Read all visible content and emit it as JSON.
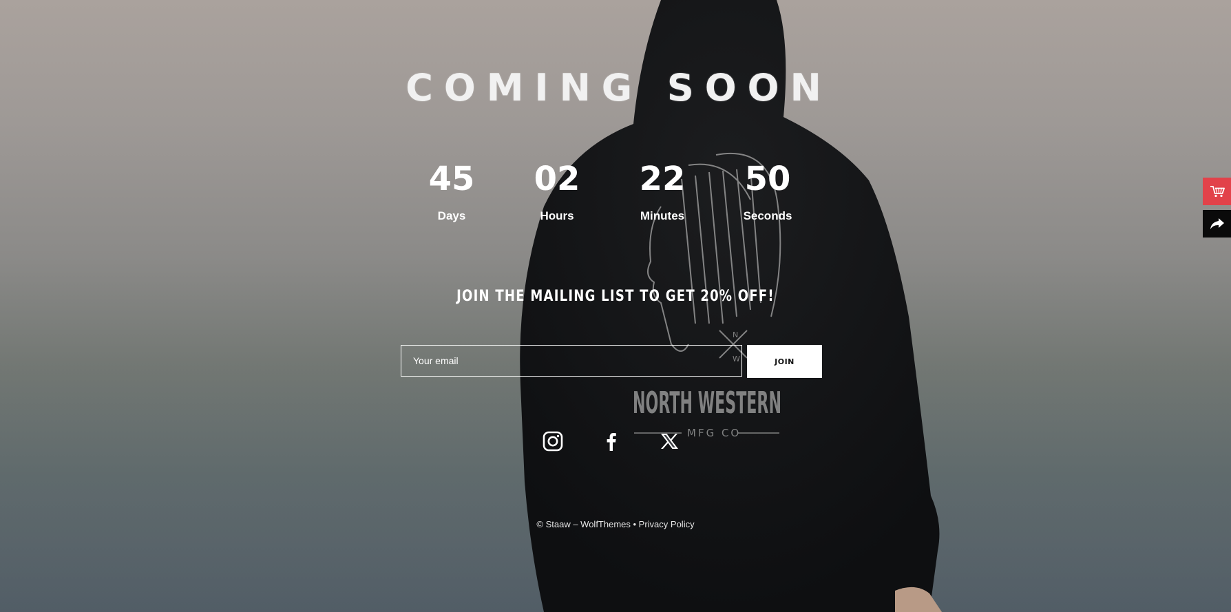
{
  "page": {
    "title": "COMING SOON"
  },
  "countdown": [
    {
      "value": "45",
      "label": "Days"
    },
    {
      "value": "02",
      "label": "Hours"
    },
    {
      "value": "22",
      "label": "Minutes"
    },
    {
      "value": "50",
      "label": "Seconds"
    }
  ],
  "mailing": {
    "heading": "JOIN THE MAILING LIST TO GET 20% OFF!",
    "email_placeholder": "Your email",
    "email_value": "",
    "join_label": "JOIN"
  },
  "social": {
    "icons": [
      "instagram-icon",
      "facebook-icon",
      "x-twitter-icon"
    ]
  },
  "footer": {
    "copyright": "© Staaw – WolfThemes",
    "separator": " • ",
    "privacy_link": "Privacy Policy"
  },
  "side_buttons": {
    "cart_icon": "cart-icon",
    "share_icon": "share-icon",
    "cart_color": "#e2424a",
    "share_color": "#0a0a0a"
  },
  "hoodie_print": {
    "brand": "NORTH WESTERN",
    "sub": "MFG CO",
    "compass": [
      "N",
      "W"
    ]
  }
}
